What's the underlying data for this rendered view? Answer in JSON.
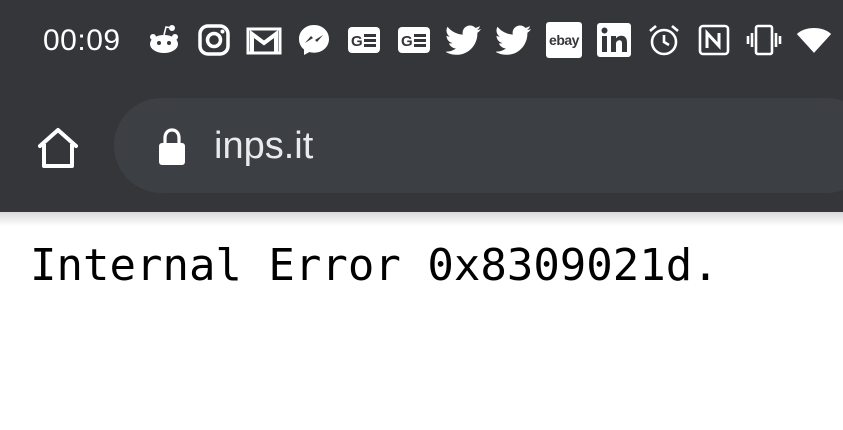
{
  "status_bar": {
    "time": "00:09",
    "icons": [
      "reddit-icon",
      "instagram-icon",
      "gmail-icon",
      "messenger-icon",
      "google-news-icon",
      "google-news-icon",
      "twitter-icon",
      "twitter-icon",
      "ebay-icon",
      "linkedin-icon",
      "alarm-icon",
      "nfc-icon",
      "vibrate-icon",
      "wifi-icon"
    ],
    "ebay_label": "ebay"
  },
  "toolbar": {
    "url": "inps.it"
  },
  "page": {
    "error_text": "Internal Error 0x8309021d."
  },
  "colors": {
    "toolbar_bg": "#35363a",
    "omnibox_bg": "#3c3f43",
    "page_bg": "#ffffff"
  }
}
